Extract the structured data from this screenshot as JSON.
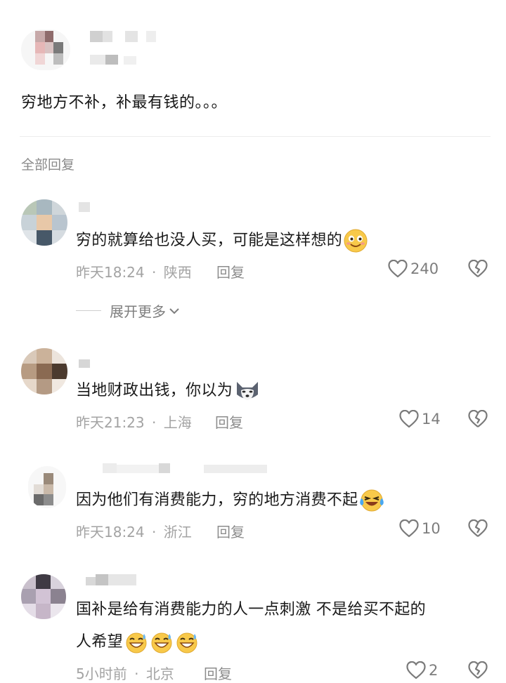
{
  "main_comment": {
    "text": "穷地方不补，补最有钱的。。。"
  },
  "replies_header": "全部回复",
  "expand_more": "展开更多",
  "colors": {
    "meta": "#a3a3a3",
    "text": "#1a1a1a",
    "emoji_yellow": "#f8c94a"
  },
  "replies": [
    {
      "text": "穷的就算给也没人买，可能是这样想的",
      "emoji": "smiling-face-icon",
      "time": "昨天18:24",
      "location": "陕西",
      "reply_label": "回复",
      "likes": "240"
    },
    {
      "text": "当地财政出钱，你以为",
      "emoji": "husky-dog-icon",
      "time": "昨天21:23",
      "location": "上海",
      "reply_label": "回复",
      "likes": "14"
    },
    {
      "text": "因为他们有消费能力，穷的地方消费不起",
      "emoji": "laughing-tears-icon",
      "time": "昨天18:24",
      "location": "浙江",
      "reply_label": "回复",
      "likes": "10"
    },
    {
      "text_line1": "国补是给有消费能力的人一点刺激 不是给买不起的",
      "text_line2": "人希望",
      "emoji": "grinning-sweat-icon",
      "time": "5小时前",
      "location": "北京",
      "reply_label": "回复",
      "likes": "2"
    }
  ],
  "separator_dot": "·"
}
